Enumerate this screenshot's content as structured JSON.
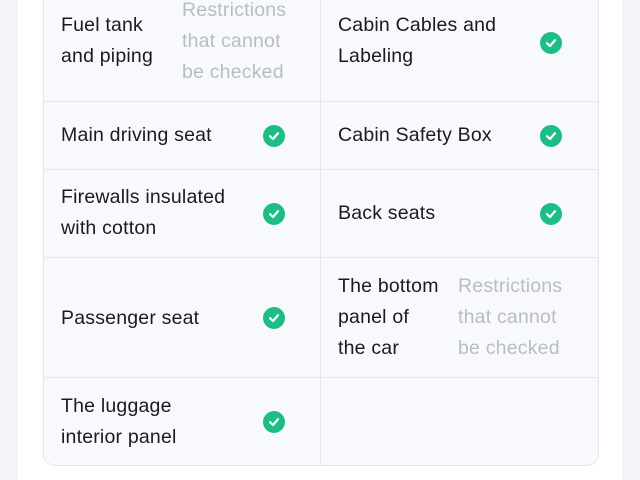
{
  "colors": {
    "check_green": "#1dbe86",
    "muted_text": "#b8bcc4",
    "border": "#e3e6ee"
  },
  "rows": [
    {
      "left": {
        "label_lines": [
          "Fuel tank",
          "and piping"
        ],
        "status": "Restrictions that cannot be checked",
        "status_lines": [
          "Restrictions",
          "that cannot",
          "be checked"
        ]
      },
      "right": {
        "label_lines": [
          "Cabin Cables and",
          "Labeling"
        ],
        "status": "check-icon"
      }
    },
    {
      "left": {
        "label_lines": [
          "Main driving seat"
        ],
        "status": "check-icon"
      },
      "right": {
        "label_lines": [
          "Cabin Safety Box"
        ],
        "status": "check-icon"
      }
    },
    {
      "left": {
        "label_lines": [
          "Firewalls insulated",
          "with cotton"
        ],
        "status": "check-icon"
      },
      "right": {
        "label_lines": [
          "Back seats"
        ],
        "status": "check-icon"
      }
    },
    {
      "left": {
        "label_lines": [
          "Passenger seat"
        ],
        "status": "check-icon"
      },
      "right": {
        "label_lines": [
          "The bottom",
          "panel of",
          "the car"
        ],
        "status": "Restrictions that cannot be checked",
        "status_lines": [
          "Restrictions",
          "that cannot",
          "be checked"
        ]
      }
    },
    {
      "left": {
        "label_lines": [
          "The luggage",
          "interior panel"
        ],
        "status": "check-icon"
      },
      "right": {
        "label_lines": [],
        "status": ""
      }
    }
  ]
}
